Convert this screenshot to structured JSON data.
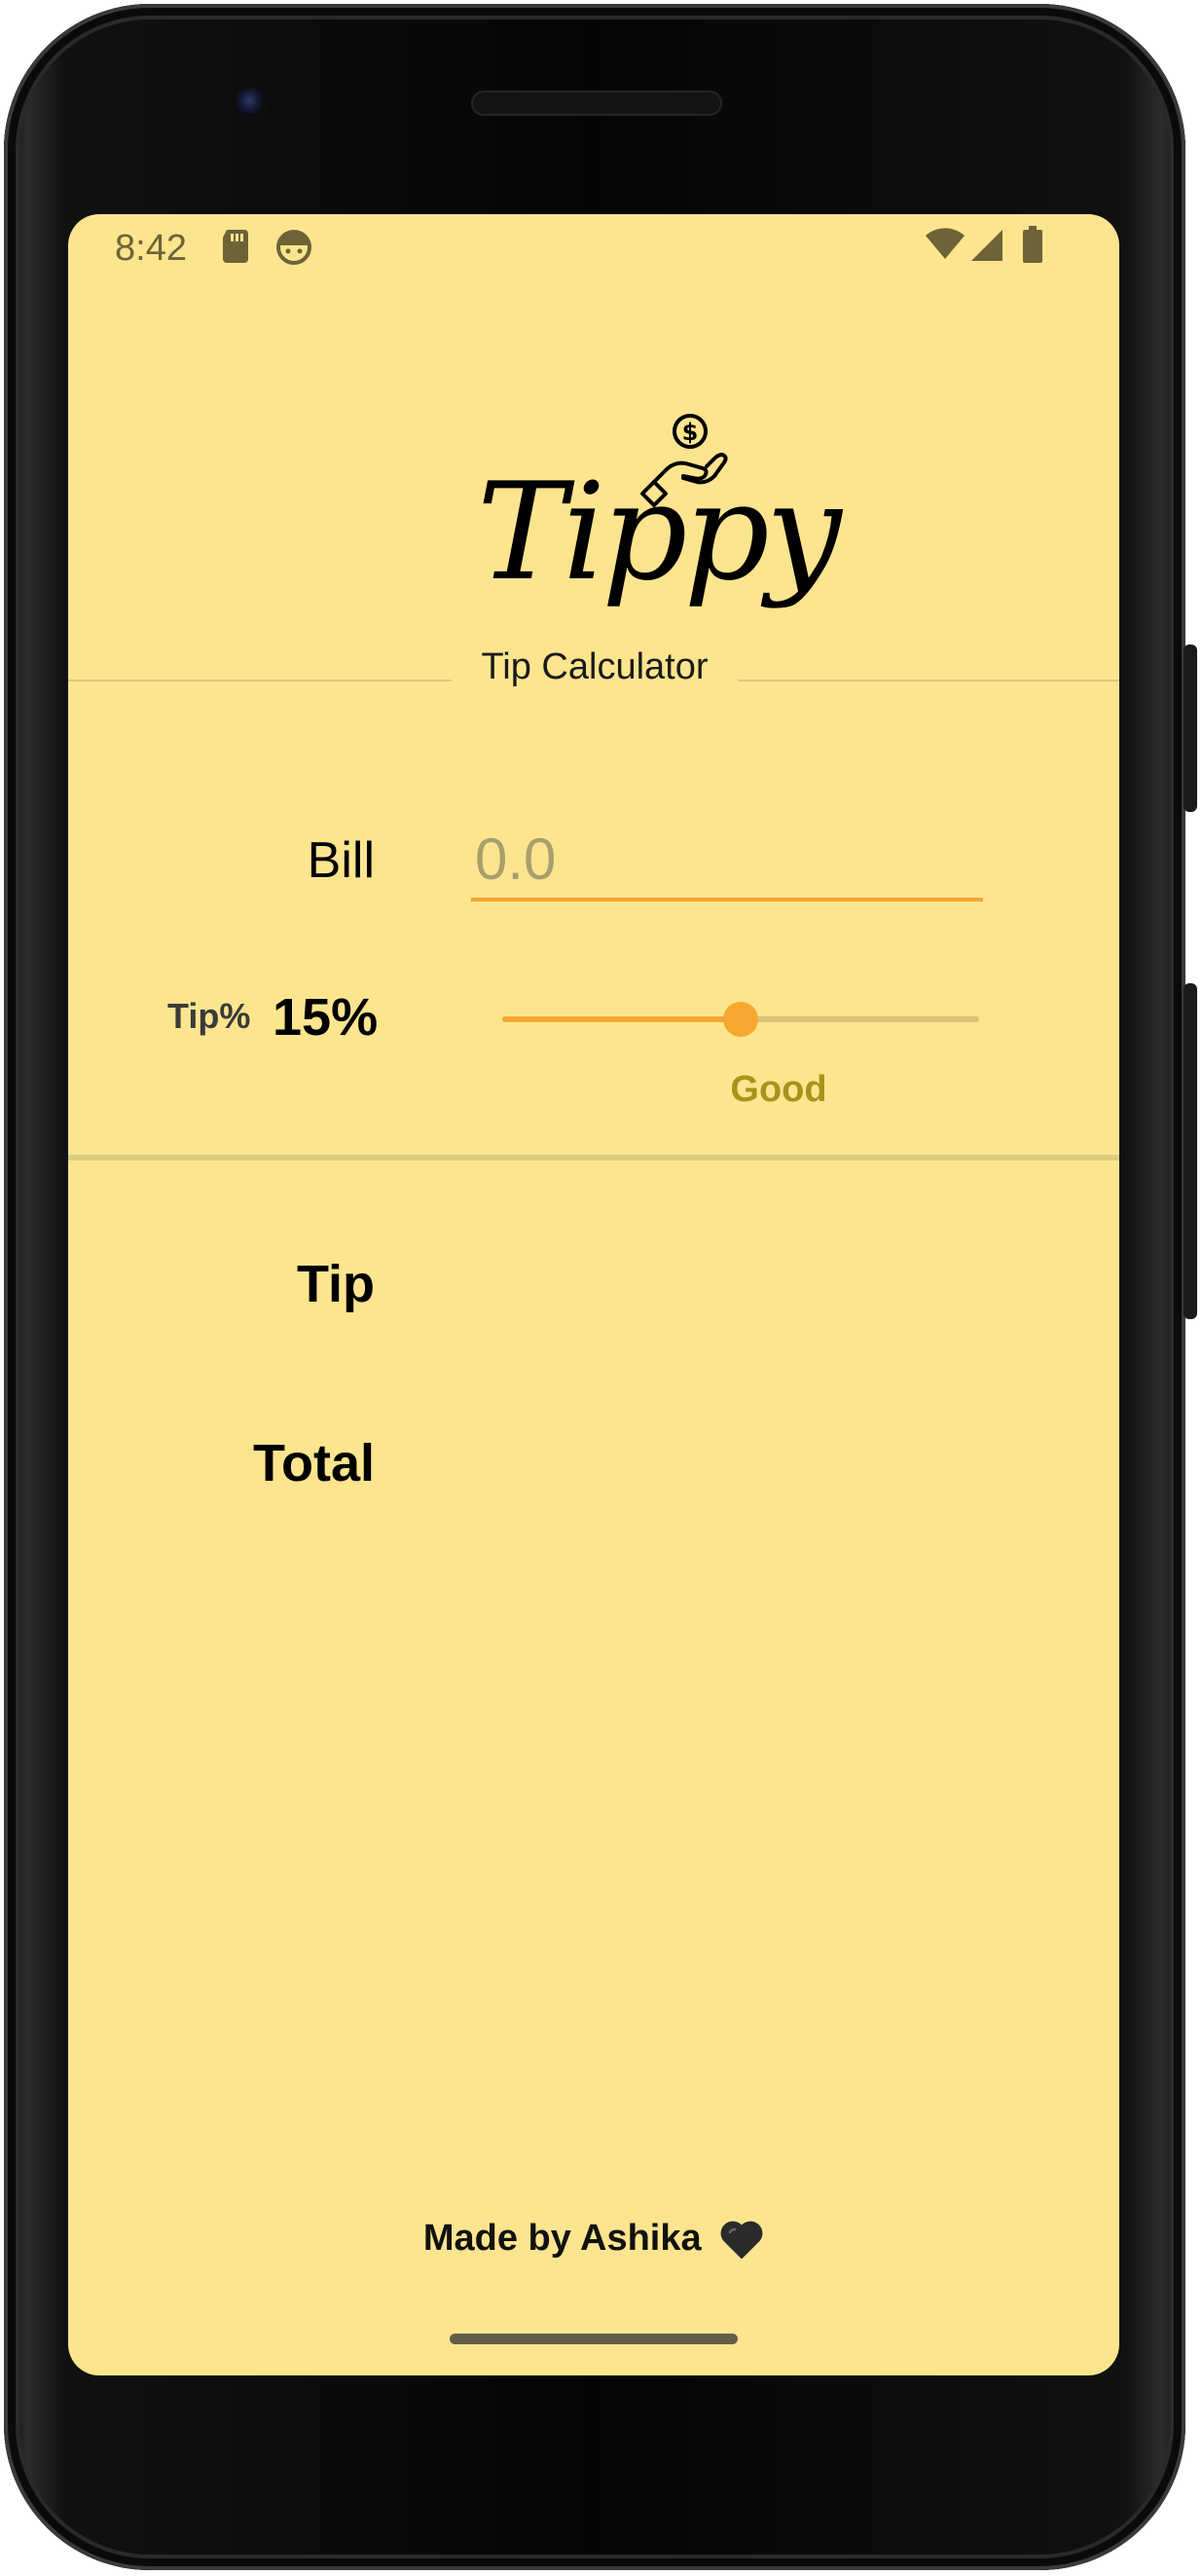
{
  "status_bar": {
    "time": "8:42",
    "icons": [
      "sd-card-icon",
      "robot-icon",
      "wifi-icon",
      "cell-signal-icon",
      "battery-icon"
    ]
  },
  "header": {
    "logo_text": "Tippy",
    "logo_icon": "hand-coin-icon",
    "subtitle": "Tip Calculator"
  },
  "form": {
    "bill_label": "Bill",
    "bill_value": "",
    "bill_placeholder": "0.0",
    "tip_label": "Tip%",
    "tip_percent_text": "15%",
    "tip_slider_value": 15,
    "tip_slider_max": 30,
    "tip_description": "Good"
  },
  "results": {
    "tip_label": "Tip",
    "tip_value": "",
    "total_label": "Total",
    "total_value": ""
  },
  "footer": {
    "text": "Made by Ashika",
    "heart_icon": "black-heart-icon"
  },
  "colors": {
    "background": "#fde58f",
    "accent": "#f6a72f",
    "description": "#a6941b"
  }
}
